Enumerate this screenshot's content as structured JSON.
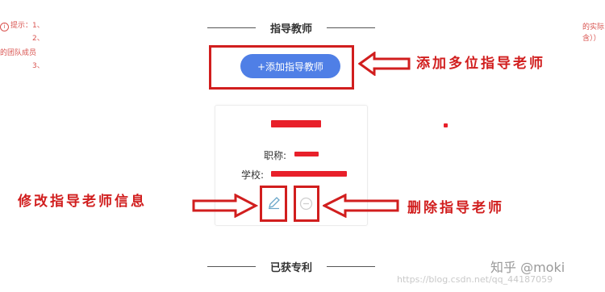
{
  "left_notes": {
    "line1": "提示：1、",
    "line2": "2、",
    "line3": "的团队成员",
    "line4": "3、"
  },
  "right_notes": {
    "line1": "的实际",
    "line2": "含））"
  },
  "section_advisor": {
    "title": "指导教师"
  },
  "add_button": {
    "label": "+添加指导教师"
  },
  "teacher_card": {
    "title_label": "职称:",
    "school_label": "学校:"
  },
  "annotations": {
    "add_multiple": "添加多位指导老师",
    "edit_info": "修改指导老师信息",
    "delete": "删除指导老师"
  },
  "section_patent": {
    "title": "已获专利"
  },
  "watermark": {
    "brand": "知乎 @moki",
    "url": "https://blog.csdn.net/qq_44187059"
  },
  "colors": {
    "button_blue": "#4f7fe6",
    "annotation_red": "#d11e1e",
    "redaction_red": "#e8202a"
  },
  "icons": {
    "edit": "pencil-icon",
    "delete": "minus-circle-icon",
    "arrow": "outline-arrow-icon"
  }
}
